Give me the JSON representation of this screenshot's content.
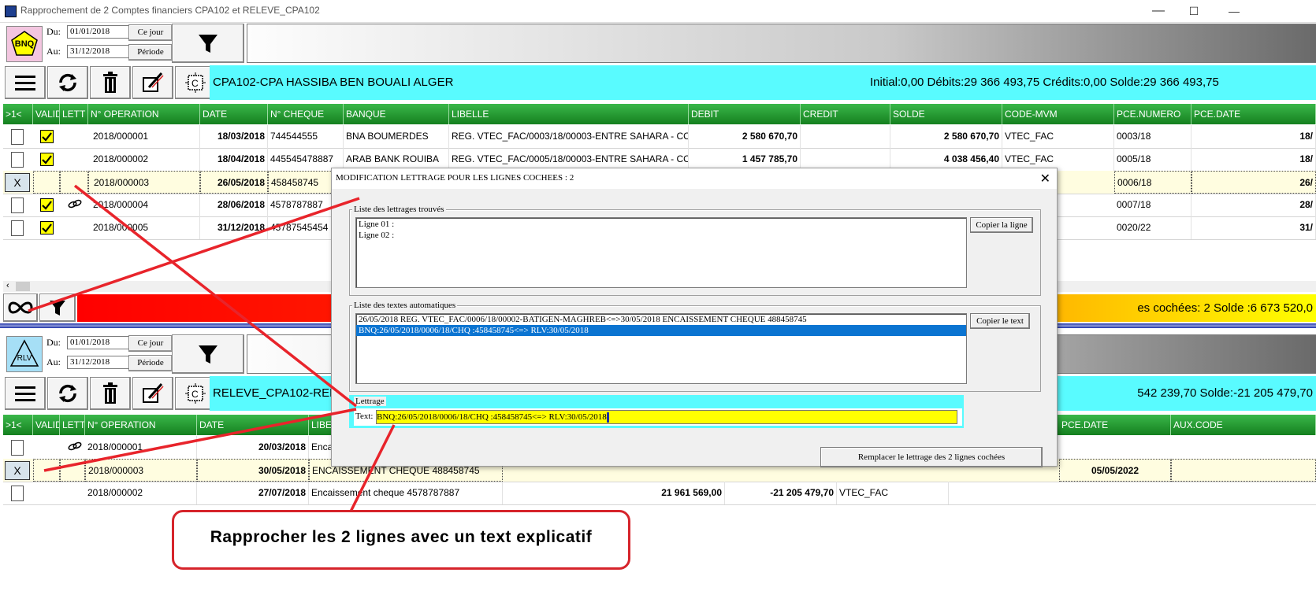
{
  "window": {
    "title": "Rapprochement de 2 Comptes financiers CPA102 et RELEVE_CPA102",
    "minimize": "—",
    "maximize": "☐",
    "close": "✕"
  },
  "top": {
    "logo": "BNQ",
    "du_label": "Du:",
    "du_value": "01/01/2018",
    "au_label": "Au:",
    "au_value": "31/12/2018",
    "ce_jour": "Ce jour",
    "periode": "Période",
    "account": "CPA102-CPA HASSIBA BEN BOUALI ALGER",
    "summary": "Initial:0,00  Débits:29 366 493,75  Crédits:0,00  Solde:29 366 493,75",
    "columns": [
      ">1<",
      "VALID",
      "LETT",
      "N° OPERATION",
      "DATE",
      "N° CHEQUE",
      "BANQUE",
      "LIBELLE",
      "DEBIT",
      "CREDIT",
      "SOLDE",
      "CODE-MVM",
      "PCE.NUMERO",
      "PCE.DATE"
    ],
    "rows": [
      {
        "op": "2018/000001",
        "date": "18/03/2018",
        "cheque": "744544555",
        "banque": "BNA BOUMERDES",
        "libelle": "REG. VTEC_FAC/0003/18/00003-ENTRE SAHARA - CO",
        "debit": "2 580 670,70",
        "credit": "",
        "solde": "2 580 670,70",
        "code": "VTEC_FAC",
        "pce_num": "0003/18",
        "pce_date": "18/"
      },
      {
        "op": "2018/000002",
        "date": "18/04/2018",
        "cheque": "445545478887",
        "banque": "ARAB BANK ROUIBA",
        "libelle": "REG. VTEC_FAC/0005/18/00003-ENTRE SAHARA - CO",
        "debit": "1 457 785,70",
        "credit": "",
        "solde": "4 038 456,40",
        "code": "VTEC_FAC",
        "pce_num": "0005/18",
        "pce_date": "18/"
      },
      {
        "op": "2018/000003",
        "date": "26/05/2018",
        "cheque": "458458745",
        "banque": "",
        "libelle": "",
        "debit": "",
        "credit": "",
        "solde": "",
        "code": "",
        "pce_num": "0006/18",
        "pce_date": "26/"
      },
      {
        "op": "2018/000004",
        "date": "28/06/2018",
        "cheque": "4578787887",
        "banque": "",
        "libelle": "",
        "debit": "",
        "credit": "",
        "solde": "",
        "code": "",
        "pce_num": "0007/18",
        "pce_date": "28/"
      },
      {
        "op": "2018/000005",
        "date": "31/12/2018",
        "cheque": "45787545454",
        "banque": "",
        "libelle": "",
        "debit": "",
        "credit": "",
        "solde": "",
        "code": "",
        "pce_num": "0020/22",
        "pce_date": "31/"
      }
    ],
    "status_text": "es cochées: 2  Solde :6 673 520,0"
  },
  "bottom": {
    "logo": "RLV",
    "du_label": "Du:",
    "du_value": "01/01/2018",
    "au_label": "Au:",
    "au_value": "31/12/2018",
    "ce_jour": "Ce jour",
    "periode": "Période",
    "account": "RELEVE_CPA102-RELE",
    "summary": "542 239,70  Solde:-21 205 479,70",
    "columns": [
      ">1<",
      "VALID",
      "LETT",
      "N° OPERATION",
      "DATE",
      "LIBE",
      "PCE.DATE",
      "AUX.CODE"
    ],
    "rows": [
      {
        "op": "2018/000001",
        "date": "20/03/2018",
        "libelle": "Enca",
        "debit": "",
        "solde": "",
        "code": "",
        "pce_date": ""
      },
      {
        "op": "2018/000003",
        "date": "30/05/2018",
        "libelle": "ENCAISSEMENT CHEQUE 488458745",
        "debit": "",
        "solde": "",
        "code": "",
        "pce_date": "05/05/2022"
      },
      {
        "op": "2018/000002",
        "date": "27/07/2018",
        "libelle": "Encaissement cheque 4578787887",
        "debit": "21 961 569,00",
        "solde": "-21 205 479,70",
        "code": "VTEC_FAC",
        "pce_date": ""
      }
    ]
  },
  "dialog": {
    "title": "MODIFICATION LETTRAGE POUR LES LIGNES COCHEES : 2",
    "close": "✕",
    "found_group": "Liste des lettrages trouvés",
    "found_lines": [
      "Ligne 01 :",
      "Ligne 02 :"
    ],
    "copy_line": "Copier la ligne",
    "auto_group": "Liste des textes automatiques",
    "auto_lines": [
      "26/05/2018 REG. VTEC_FAC/0006/18/00002-BATIGEN-MAGHREB<=>30/05/2018 ENCAISSEMENT CHEQUE 488458745",
      "BNQ:26/05/2018/0006/18/CHQ :458458745<=> RLV:30/05/2018"
    ],
    "copy_text": "Copier le text",
    "lettrage_group": "Lettrage",
    "text_label": "Text:",
    "text_value": "BNQ:26/05/2018/0006/18/CHQ :458458745<=> RLV:30/05/2018",
    "replace_button": "Remplacer le lettrage des 2 lignes cochées"
  },
  "callout": {
    "text": "Rapprocher les 2 lignes avec un text explicatif"
  },
  "colors": {
    "cyan": "#59fbff",
    "green": "#15801f",
    "red": "#ff0000",
    "yellow": "#ffff00",
    "accent_red": "#d6242b",
    "selection": "#0b74d1"
  }
}
